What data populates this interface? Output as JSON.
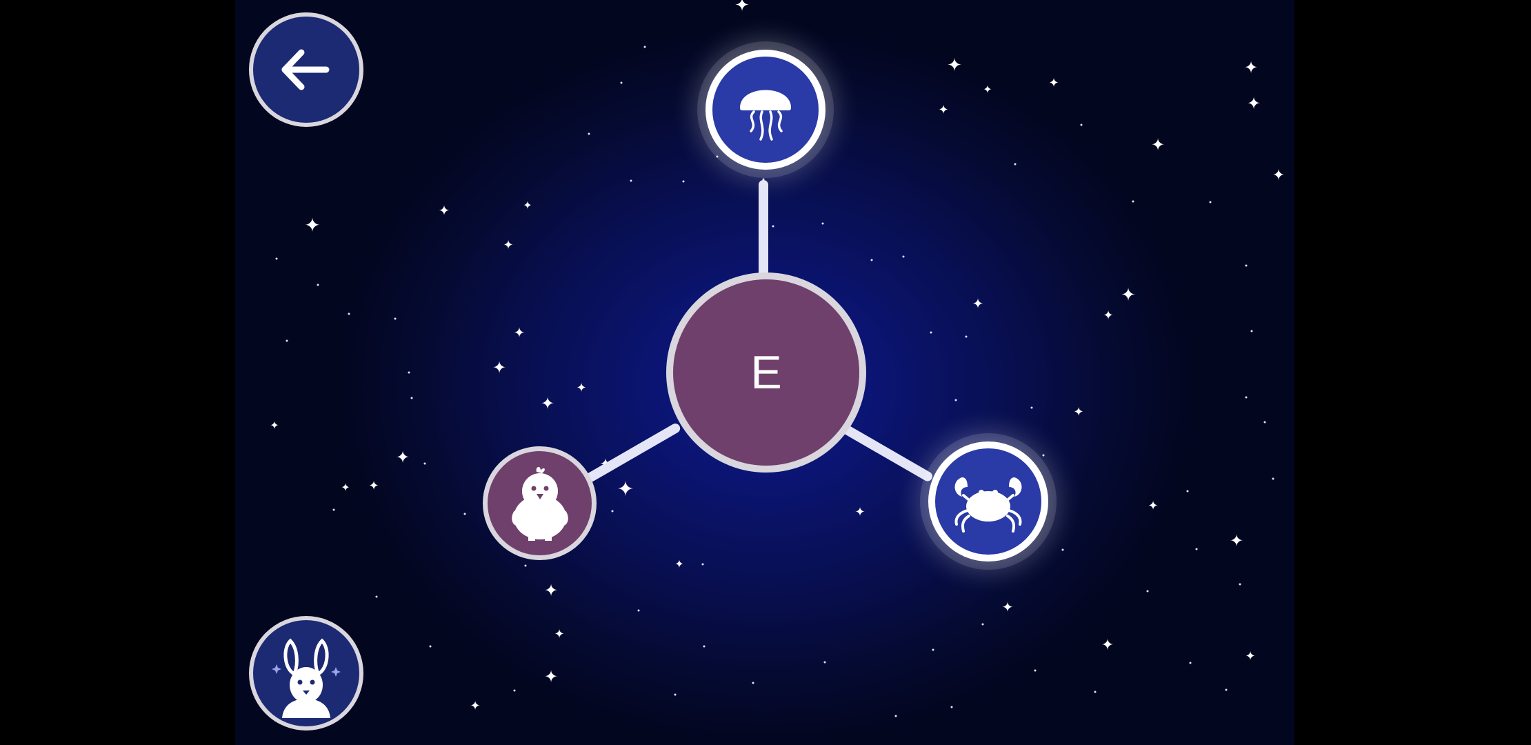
{
  "screen": {
    "center_node": {
      "label": "E",
      "color": "#70406c"
    },
    "back_button": {
      "icon": "arrow-left-icon",
      "color": "#1b2a72"
    },
    "profile_button": {
      "icon": "rabbit-avatar-icon",
      "color": "#1b2a72"
    },
    "nodes": [
      {
        "name": "jellyfish",
        "icon": "jellyfish-icon",
        "color": "#2a3aa6",
        "highlighted": true
      },
      {
        "name": "chick",
        "icon": "chick-icon",
        "color": "#70406c",
        "highlighted": false
      },
      {
        "name": "crab",
        "icon": "crab-icon",
        "color": "#2a3aa6",
        "highlighted": true
      }
    ]
  }
}
